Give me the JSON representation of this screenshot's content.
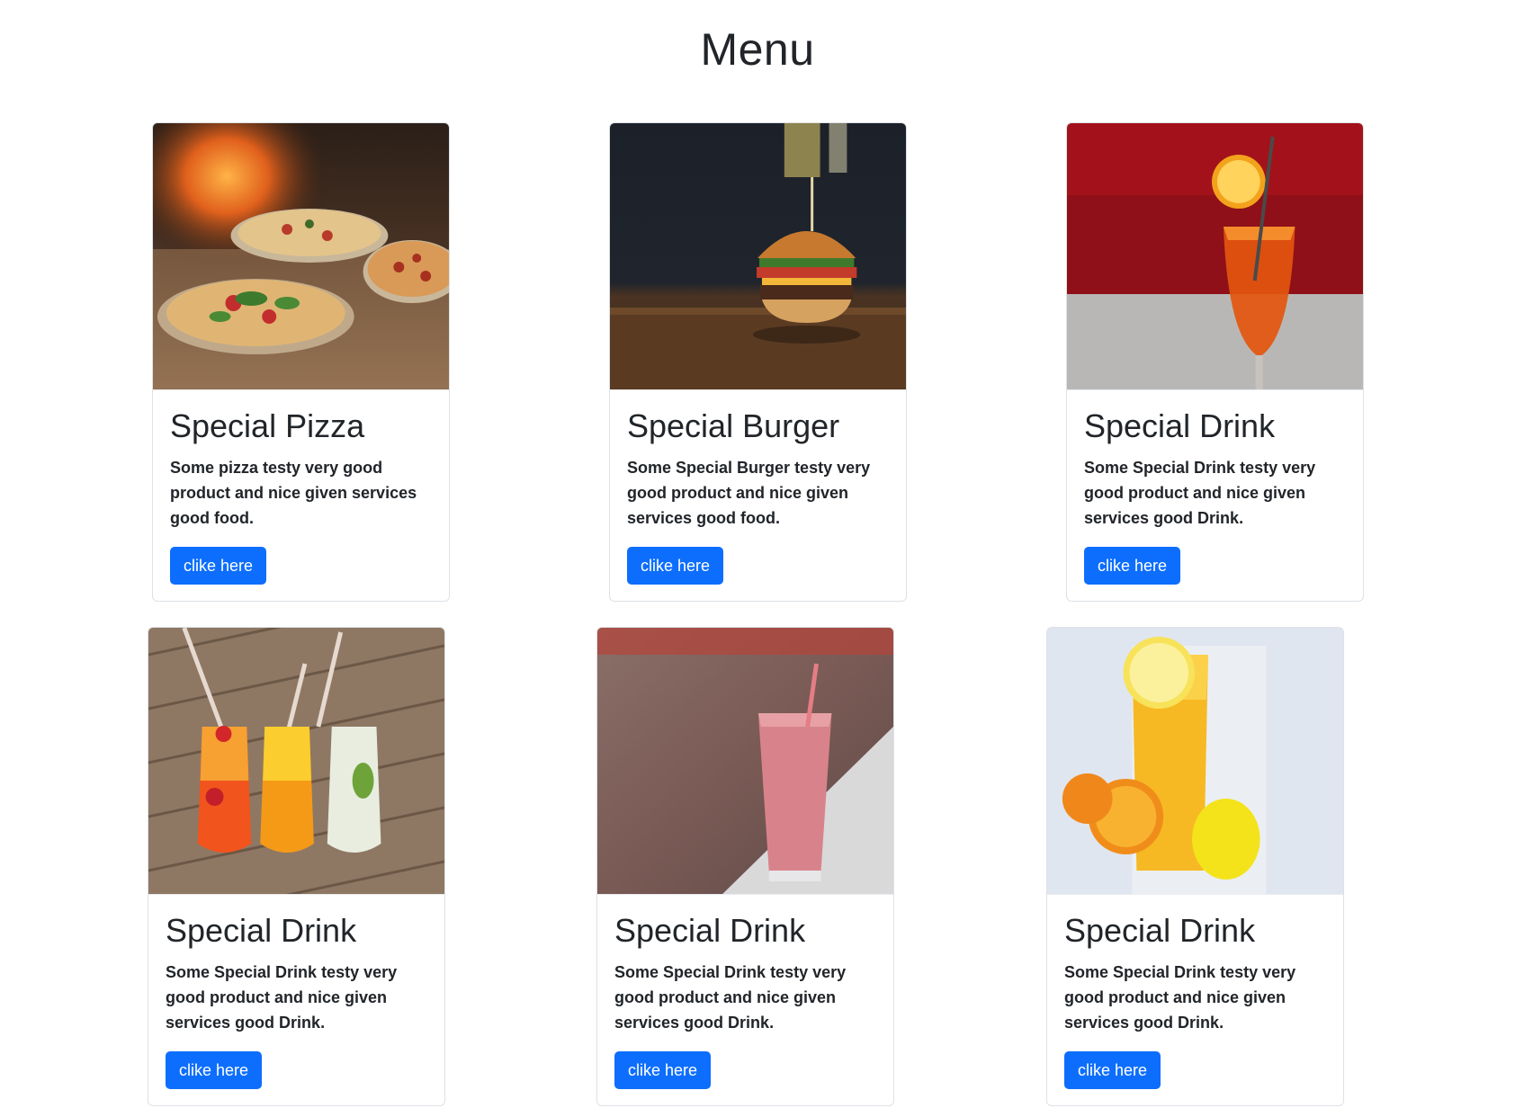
{
  "page": {
    "title": "Menu"
  },
  "cards": [
    {
      "title": "Special Pizza",
      "text": "Some pizza testy very good product and nice given services good food.",
      "button": "clike here"
    },
    {
      "title": "Special Burger",
      "text": "Some Special Burger testy very good product and nice given services good food.",
      "button": "clike here"
    },
    {
      "title": "Special Drink",
      "text": "Some Special Drink testy very good product and nice given services good Drink.",
      "button": "clike here"
    },
    {
      "title": "Special Drink",
      "text": "Some Special Drink testy very good product and nice given services good Drink.",
      "button": "clike here"
    },
    {
      "title": "Special Drink",
      "text": "Some Special Drink testy very good product and nice given services good Drink.",
      "button": "clike here"
    },
    {
      "title": "Special Drink",
      "text": "Some Special Drink testy very good product and nice given services good Drink.",
      "button": "clike here"
    }
  ],
  "colors": {
    "button": "#0d6efd",
    "text": "#212529",
    "border": "#dee2e6"
  }
}
